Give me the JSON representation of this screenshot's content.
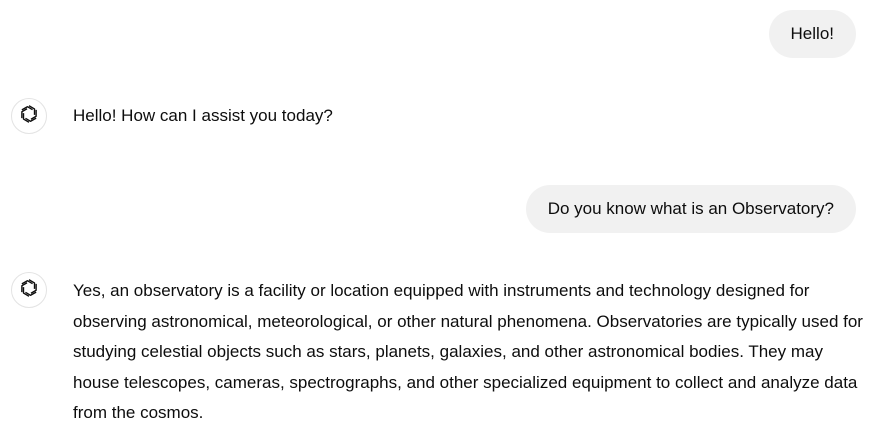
{
  "conversation": {
    "messages": [
      {
        "role": "user",
        "text": "Hello!"
      },
      {
        "role": "assistant",
        "avatar_icon": "openai-logo-icon",
        "text": "Hello! How can I assist you today?"
      },
      {
        "role": "user",
        "text": "Do you know what is an Observatory?"
      },
      {
        "role": "assistant",
        "avatar_icon": "openai-logo-icon",
        "text": "Yes, an observatory is a facility or location equipped with instruments and technology designed for observing astronomical, meteorological, or other natural phenomena. Observatories are typically used for studying celestial objects such as stars, planets, galaxies, and other astronomical bodies. They may house telescopes, cameras, spectrographs, and other specialized equipment to collect and analyze data from the cosmos."
      }
    ]
  },
  "colors": {
    "user_bubble_bg": "#f1f1f1",
    "text": "#0d0d0d",
    "avatar_border": "#e3e3e3"
  }
}
